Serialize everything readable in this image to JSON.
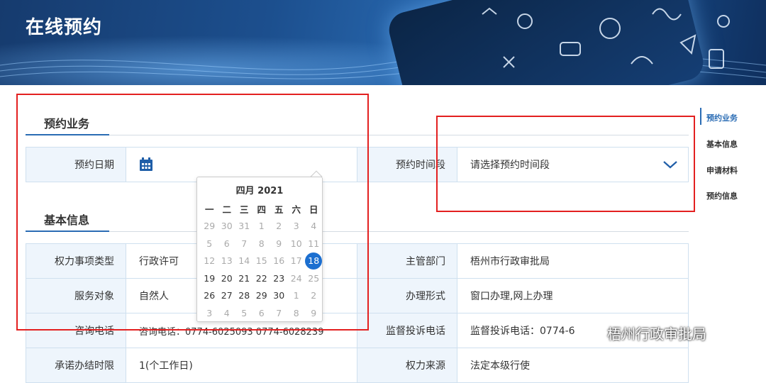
{
  "banner": {
    "title": "在线预约"
  },
  "sections": {
    "appointment": "预约业务",
    "basic": "基本信息"
  },
  "appointment_row": {
    "date_label": "预约日期",
    "time_label": "预约时间段",
    "time_placeholder": "请选择预约时间段"
  },
  "calendar": {
    "header": "四月 2021",
    "weekdays": [
      "一",
      "二",
      "三",
      "四",
      "五",
      "六",
      "日"
    ],
    "days": [
      [
        "29",
        "30",
        "31",
        "1",
        "2",
        "3",
        "4"
      ],
      [
        "5",
        "6",
        "7",
        "8",
        "9",
        "10",
        "11"
      ],
      [
        "12",
        "13",
        "14",
        "15",
        "16",
        "17",
        "18"
      ],
      [
        "19",
        "20",
        "21",
        "22",
        "23",
        "24",
        "25"
      ],
      [
        "26",
        "27",
        "28",
        "29",
        "30",
        "1",
        "2"
      ],
      [
        "3",
        "4",
        "5",
        "6",
        "7",
        "8",
        "9"
      ]
    ],
    "selected": "18"
  },
  "info_rows": [
    {
      "l1": "权力事项类型",
      "v1": "行政许可",
      "l2": "主管部门",
      "v2": "梧州市行政审批局"
    },
    {
      "l1": "服务对象",
      "v1": "自然人",
      "l2": "办理形式",
      "v2": "窗口办理,网上办理"
    },
    {
      "l1": "咨询电话",
      "v1": "咨询电话：0774-6025093 0774-6028239",
      "l2": "监督投诉电话",
      "v2": "监督投诉电话：0774-6"
    },
    {
      "l1": "承诺办结时限",
      "v1": "1(个工作日)",
      "l2": "权力来源",
      "v2": "法定本级行使"
    }
  ],
  "side_nav": [
    "预约业务",
    "基本信息",
    "申请材料",
    "预约信息"
  ],
  "watermark": {
    "text": "梧州行政审批局"
  },
  "colors": {
    "accent": "#2a6cb4",
    "highlight": "#e32020",
    "label_bg": "#eef5fc"
  }
}
